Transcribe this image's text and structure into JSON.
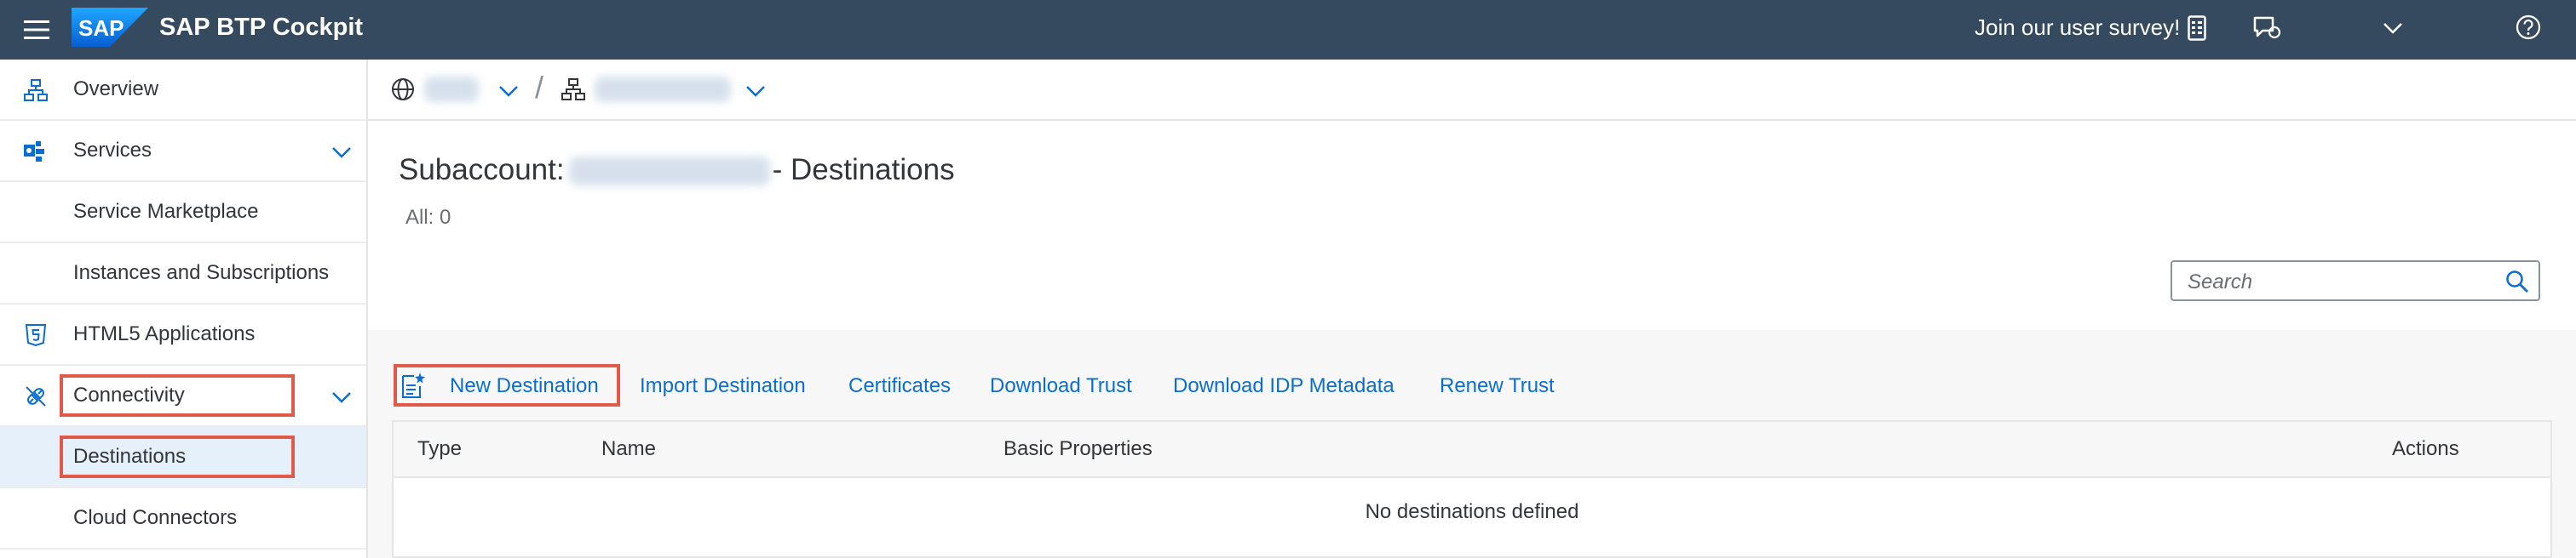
{
  "shell": {
    "logo_text": "SAP",
    "title": "SAP BTP Cockpit",
    "survey_label": "Join our user survey!",
    "colors": {
      "background": "#354a5f",
      "accent": "#0a6ed1",
      "highlight": "#e05a4a"
    }
  },
  "sidebar": {
    "items": [
      {
        "label": "Overview",
        "icon": "hierarchy-icon"
      },
      {
        "label": "Services",
        "icon": "services-icon"
      },
      {
        "label": "Service Marketplace"
      },
      {
        "label": "Instances and Subscriptions"
      },
      {
        "label": "HTML5 Applications",
        "icon": "html5-icon"
      },
      {
        "label": "Connectivity",
        "icon": "connectivity-icon"
      },
      {
        "label": "Destinations"
      },
      {
        "label": "Cloud Connectors"
      }
    ]
  },
  "breadcrumb": {
    "separator": "/"
  },
  "page": {
    "title_prefix": "Subaccount:",
    "title_suffix": "- Destinations",
    "count": "All: 0"
  },
  "search": {
    "placeholder": "Search"
  },
  "toolbar": {
    "new_destination": "New Destination",
    "import_destination": "Import Destination",
    "certificates": "Certificates",
    "download_trust": "Download Trust",
    "download_idp_metadata": "Download IDP Metadata",
    "renew_trust": "Renew Trust"
  },
  "table": {
    "columns": [
      "Type",
      "Name",
      "Basic Properties",
      "Actions"
    ],
    "empty_text": "No destinations defined"
  }
}
